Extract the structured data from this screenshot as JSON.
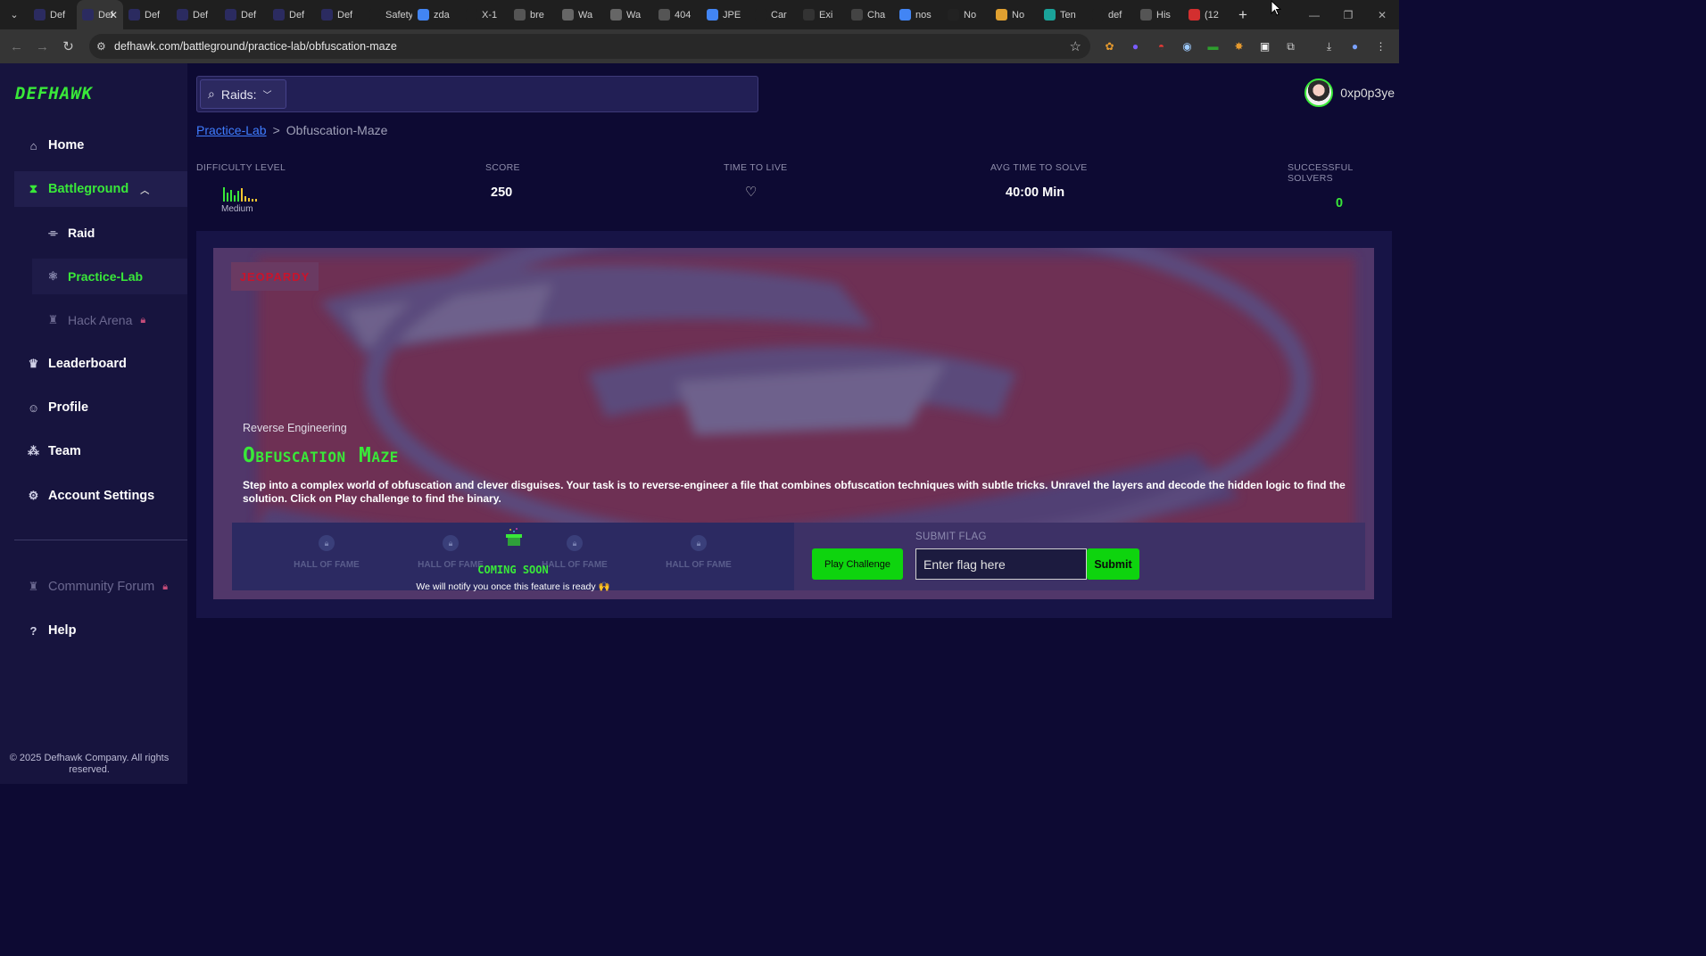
{
  "browser": {
    "tabs": [
      {
        "label": "Def",
        "color": "#2b2b60",
        "icon": "shield-icon"
      },
      {
        "label": "Def",
        "color": "#2b2b60",
        "icon": "shield-icon",
        "active": true
      },
      {
        "label": "Def",
        "color": "#2b2b60",
        "icon": "shield-icon"
      },
      {
        "label": "Def",
        "color": "#2b2b60",
        "icon": "shield-icon"
      },
      {
        "label": "Def",
        "color": "#2b2b60",
        "icon": "shield-icon"
      },
      {
        "label": "Def",
        "color": "#2b2b60",
        "icon": "shield-icon"
      },
      {
        "label": "Def",
        "color": "#2b2b60",
        "icon": "shield-icon"
      },
      {
        "label": "Safety w",
        "color": "#1f1f1f",
        "icon": "blank-icon"
      },
      {
        "label": "zda",
        "color": "#4285f4",
        "icon": "google-icon"
      },
      {
        "label": "X-1",
        "color": "#1f1f1f",
        "icon": "blank-icon"
      },
      {
        "label": "bre",
        "color": "#555",
        "icon": "globe-icon"
      },
      {
        "label": "Wa",
        "color": "#666",
        "icon": "archive-icon"
      },
      {
        "label": "Wa",
        "color": "#666",
        "icon": "archive-icon"
      },
      {
        "label": "404",
        "color": "#555",
        "icon": "globe-icon"
      },
      {
        "label": "JPE",
        "color": "#4285f4",
        "icon": "google-icon"
      },
      {
        "label": "Car",
        "color": "#1f1f1f",
        "icon": "blank-icon"
      },
      {
        "label": "Exi",
        "color": "#333",
        "icon": "exif-icon"
      },
      {
        "label": "Cha",
        "color": "#444",
        "icon": "chatgpt-icon"
      },
      {
        "label": "nos",
        "color": "#4285f4",
        "icon": "google-icon"
      },
      {
        "label": "No",
        "color": "#222",
        "icon": "medium-icon"
      },
      {
        "label": "No",
        "color": "#e0a030",
        "icon": "pen-icon"
      },
      {
        "label": "Ten",
        "color": "#1aa39a",
        "icon": "temp-mail-icon"
      },
      {
        "label": "def",
        "color": "#1f1f1f",
        "icon": "blank-icon"
      },
      {
        "label": "His",
        "color": "#555",
        "icon": "history-icon"
      },
      {
        "label": "(12",
        "color": "#d32f2f",
        "icon": "video-icon"
      }
    ],
    "url": "defhawk.com/battleground/practice-lab/obfuscation-maze"
  },
  "sidebar": {
    "logo": "DEFHAWK",
    "items": [
      {
        "label": "Home",
        "icon": "home-icon"
      },
      {
        "label": "Battleground",
        "icon": "hourglass-icon"
      },
      {
        "label": "Raid",
        "icon": "raid-icon"
      },
      {
        "label": "Practice-Lab",
        "icon": "atom-icon"
      },
      {
        "label": "Hack Arena",
        "icon": "arena-icon"
      },
      {
        "label": "Leaderboard",
        "icon": "trophy-icon"
      },
      {
        "label": "Profile",
        "icon": "profile-icon"
      },
      {
        "label": "Team",
        "icon": "team-icon"
      },
      {
        "label": "Account Settings",
        "icon": "gear-icon"
      },
      {
        "label": "Community Forum",
        "icon": "forum-icon"
      },
      {
        "label": "Help",
        "icon": "help-icon"
      }
    ],
    "copyright": "© 2025 Defhawk Company. All rights reserved."
  },
  "header": {
    "search_select": "Raids:",
    "username": "0xp0p3ye"
  },
  "breadcrumb": {
    "parent": "Practice-Lab",
    "separator": ">",
    "current": "Obfuscation-Maze"
  },
  "stats": {
    "difficulty_label": "DIFFICULTY LEVEL",
    "difficulty_value": "Medium",
    "score_label": "SCORE",
    "score_value": "250",
    "ttl_label": "TIME TO LIVE",
    "avg_label": "AVG TIME TO SOLVE",
    "avg_value": "40:00 Min",
    "solvers_label": "SUCCESSFUL SOLVERS",
    "solvers_value": "0",
    "solvers_color": "#39e839"
  },
  "challenge": {
    "badge": "JEOPARDY",
    "category": "Reverse Engineering",
    "title": "Obfuscation Maze",
    "description": "Step into a complex world of obfuscation and clever disguises. Your task is to reverse-engineer a file that combines obfuscation techniques with subtle tricks. Unravel the layers and decode the hidden logic to find the solution. Click on Play challenge to find the binary.",
    "hall_of_fame": [
      "HALL OF FAME",
      "HALL OF FAME",
      "HALL OF FAME",
      "HALL OF FAME"
    ],
    "coming_soon": "COMING SOON",
    "notify": "We will notify you once this feature is ready 🙌",
    "play_button": "Play Challenge",
    "flag_label": "SUBMIT FLAG",
    "flag_placeholder": "Enter flag here",
    "submit_button": "Submit"
  },
  "colors": {
    "accent": "#39e839",
    "background": "#0d0a33",
    "sidebar": "#17143e",
    "badge_text": "#c8142c"
  }
}
